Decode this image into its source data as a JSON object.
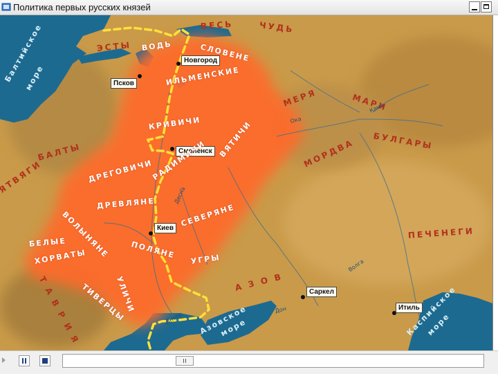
{
  "window": {
    "title": "Политика первых русских князей",
    "icons": {
      "app": "app-icon",
      "minimize": "minimize-icon",
      "maximize": "maximize-icon"
    }
  },
  "map": {
    "colors": {
      "sea": "#1d6a91",
      "land": "#c99a49",
      "territory": "#ff6a2a",
      "route": "#ffe03a"
    },
    "cities": {
      "novgorod": "Новгород",
      "pskov": "Псков",
      "smolensk": "Смоленск",
      "kiev": "Киев",
      "sarkel": "Саркел",
      "itil": "Итиль"
    },
    "regions": {
      "ves": "ВЕСЬ",
      "chud": "ЧУДЬ",
      "esty": "ЭСТЫ",
      "merya": "МЕРЯ",
      "mari": "МАРИ",
      "bulgary": "БУЛГАРЫ",
      "mordva": "МОРДВА",
      "balty": "БАЛТЫ",
      "yatvyagi": "ЯТВЯГИ",
      "pechenegi": "ПЕЧЕНЕГИ",
      "azov_letters": "А З О В",
      "crimea_letters": "Т А В Р И Я"
    },
    "tribes": {
      "vod": "ВОДЬ",
      "slovene": "СЛОВЕНЕ",
      "ilmenskie": "ИЛЬМЕНСКИЕ",
      "krivichi": "КРИВИЧИ",
      "vyatichi": "ВЯТИЧИ",
      "dregovichi": "ДРЕГОВИЧИ",
      "radimichi": "РАДИМИЧИ",
      "drevlyane": "ДРЕВЛЯНЕ",
      "severyane": "СЕВЕРЯНЕ",
      "volynyane": "ВОЛЫНЯНЕ",
      "polyane": "ПОЛЯНЕ",
      "belye": "БЕЛЫЕ",
      "horvaty": "ХОРВАТЫ",
      "tivertsy": "ТИВЕРЦЫ",
      "ulichi": "УЛИЧИ",
      "ugry": "УГРЫ"
    },
    "seas": {
      "baltic_1": "Балтийское",
      "baltic_2": "море",
      "azov_1": "Азовское",
      "azov_2": "море",
      "caspian_1": "Каспийское",
      "caspian_2": "море"
    },
    "rivers": {
      "oka": "Ока",
      "kama": "Кама",
      "volga": "Волга",
      "desna": "Десна",
      "don": "Дон",
      "dnepr": "Днепр"
    }
  },
  "player": {
    "icons": {
      "pause": "pause-icon",
      "stop": "stop-icon",
      "play": "play-arrow-icon"
    },
    "progress": 0.28
  }
}
